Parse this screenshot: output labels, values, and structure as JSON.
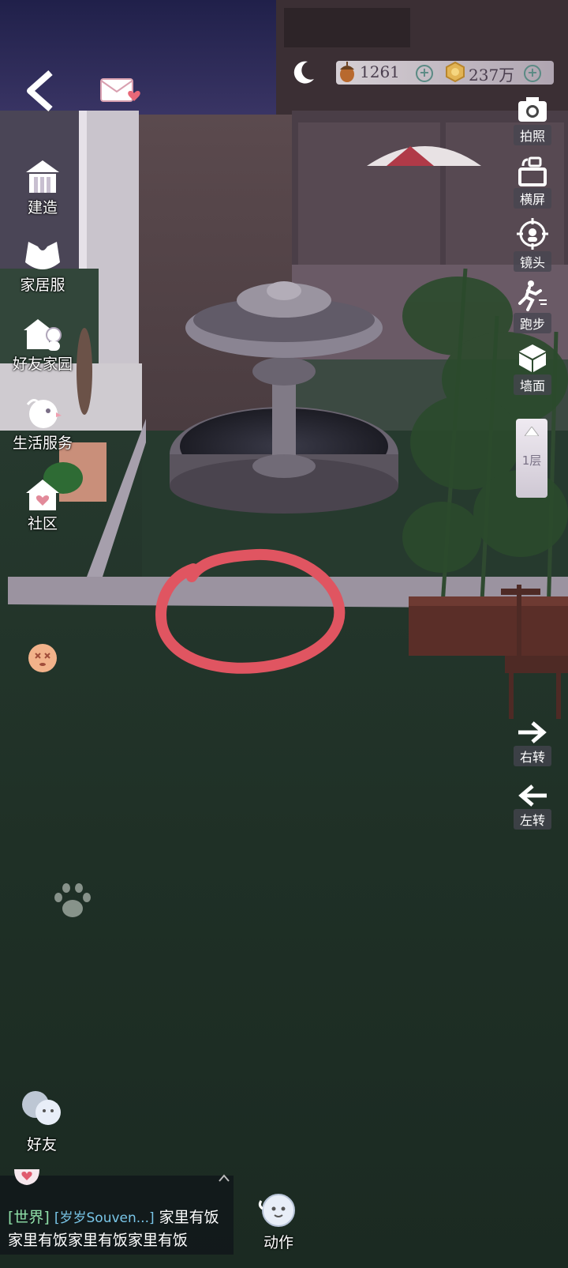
{
  "currency": {
    "acorn_value": "1261",
    "coin_value": "237万"
  },
  "left_menu": {
    "build": "建造",
    "home_wear": "家居服",
    "friend_home": "好友家园",
    "life_service": "生活服务",
    "community": "社区"
  },
  "right_menu": {
    "photo": "拍照",
    "landscape": "横屏",
    "camera": "镜头",
    "run": "跑步",
    "wall": "墙面",
    "floor": "1层",
    "turn_right": "右转",
    "turn_left": "左转"
  },
  "bottom": {
    "friends": "好友",
    "actions": "动作"
  },
  "chat": {
    "channel": "[世界]",
    "sender": "[岁岁Souven...]",
    "message_part1": "家里有饭",
    "message_part2": "家里有饭家里有饭家里有饭"
  },
  "colors": {
    "annotation_circle": "#e05561",
    "grass": "#22352b",
    "night_sky": "#2a2a5a"
  }
}
